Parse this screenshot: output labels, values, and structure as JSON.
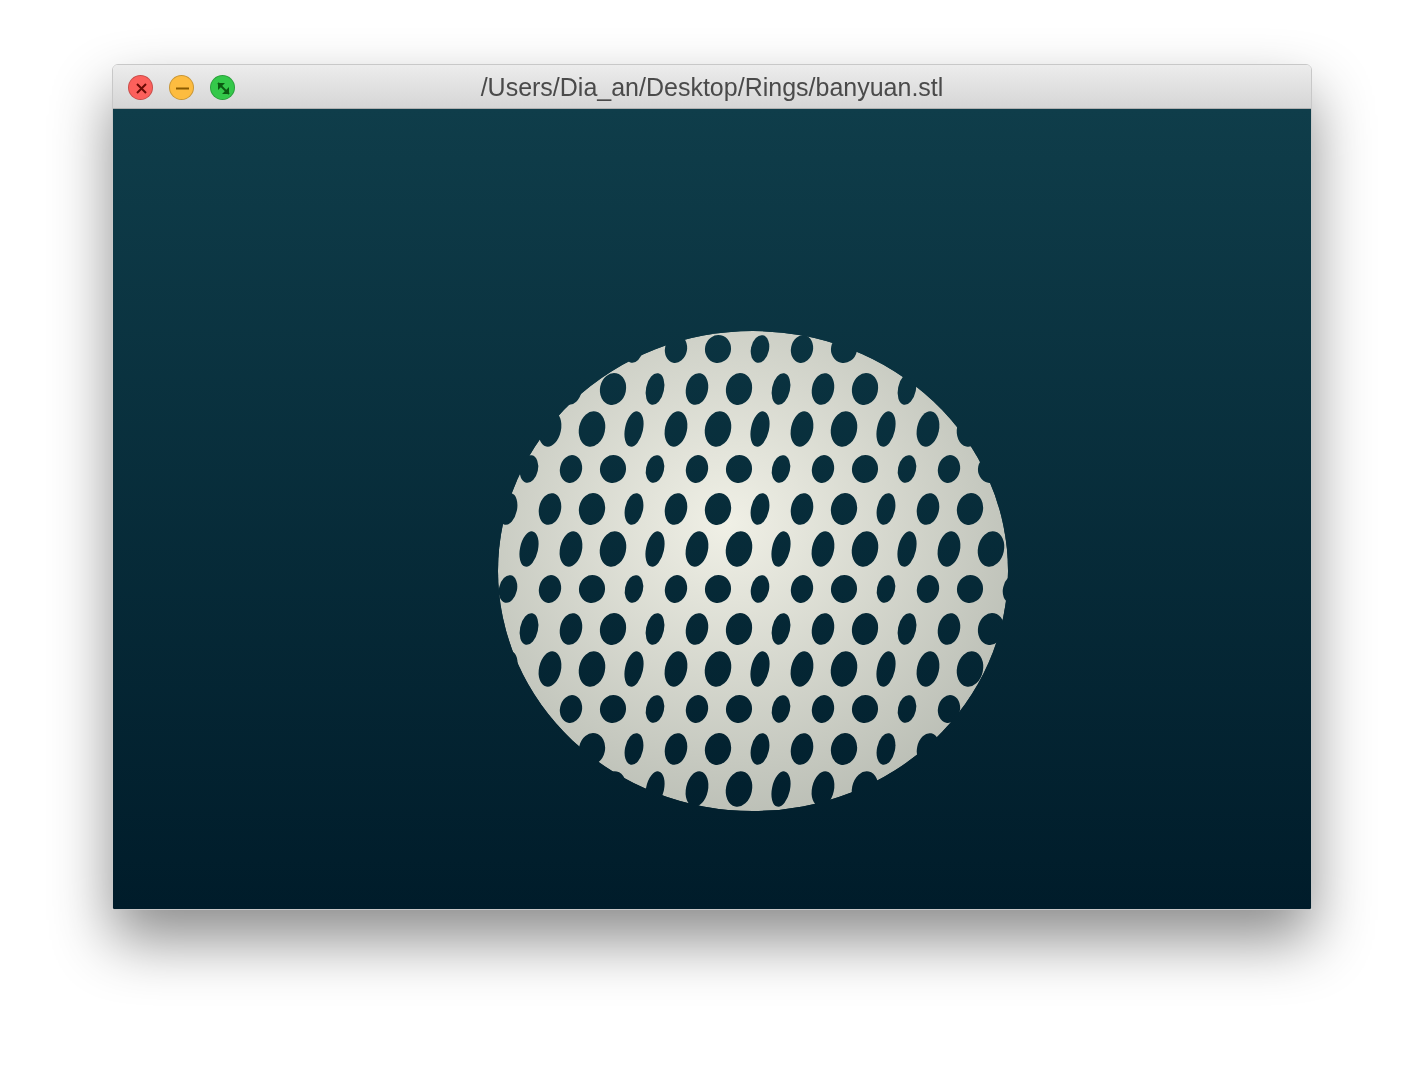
{
  "window": {
    "title": "/Users/Dia_an/Desktop/Rings/banyuan.stl"
  },
  "window_controls": [
    {
      "kind": "close"
    },
    {
      "kind": "minimize"
    },
    {
      "kind": "zoom"
    }
  ]
}
